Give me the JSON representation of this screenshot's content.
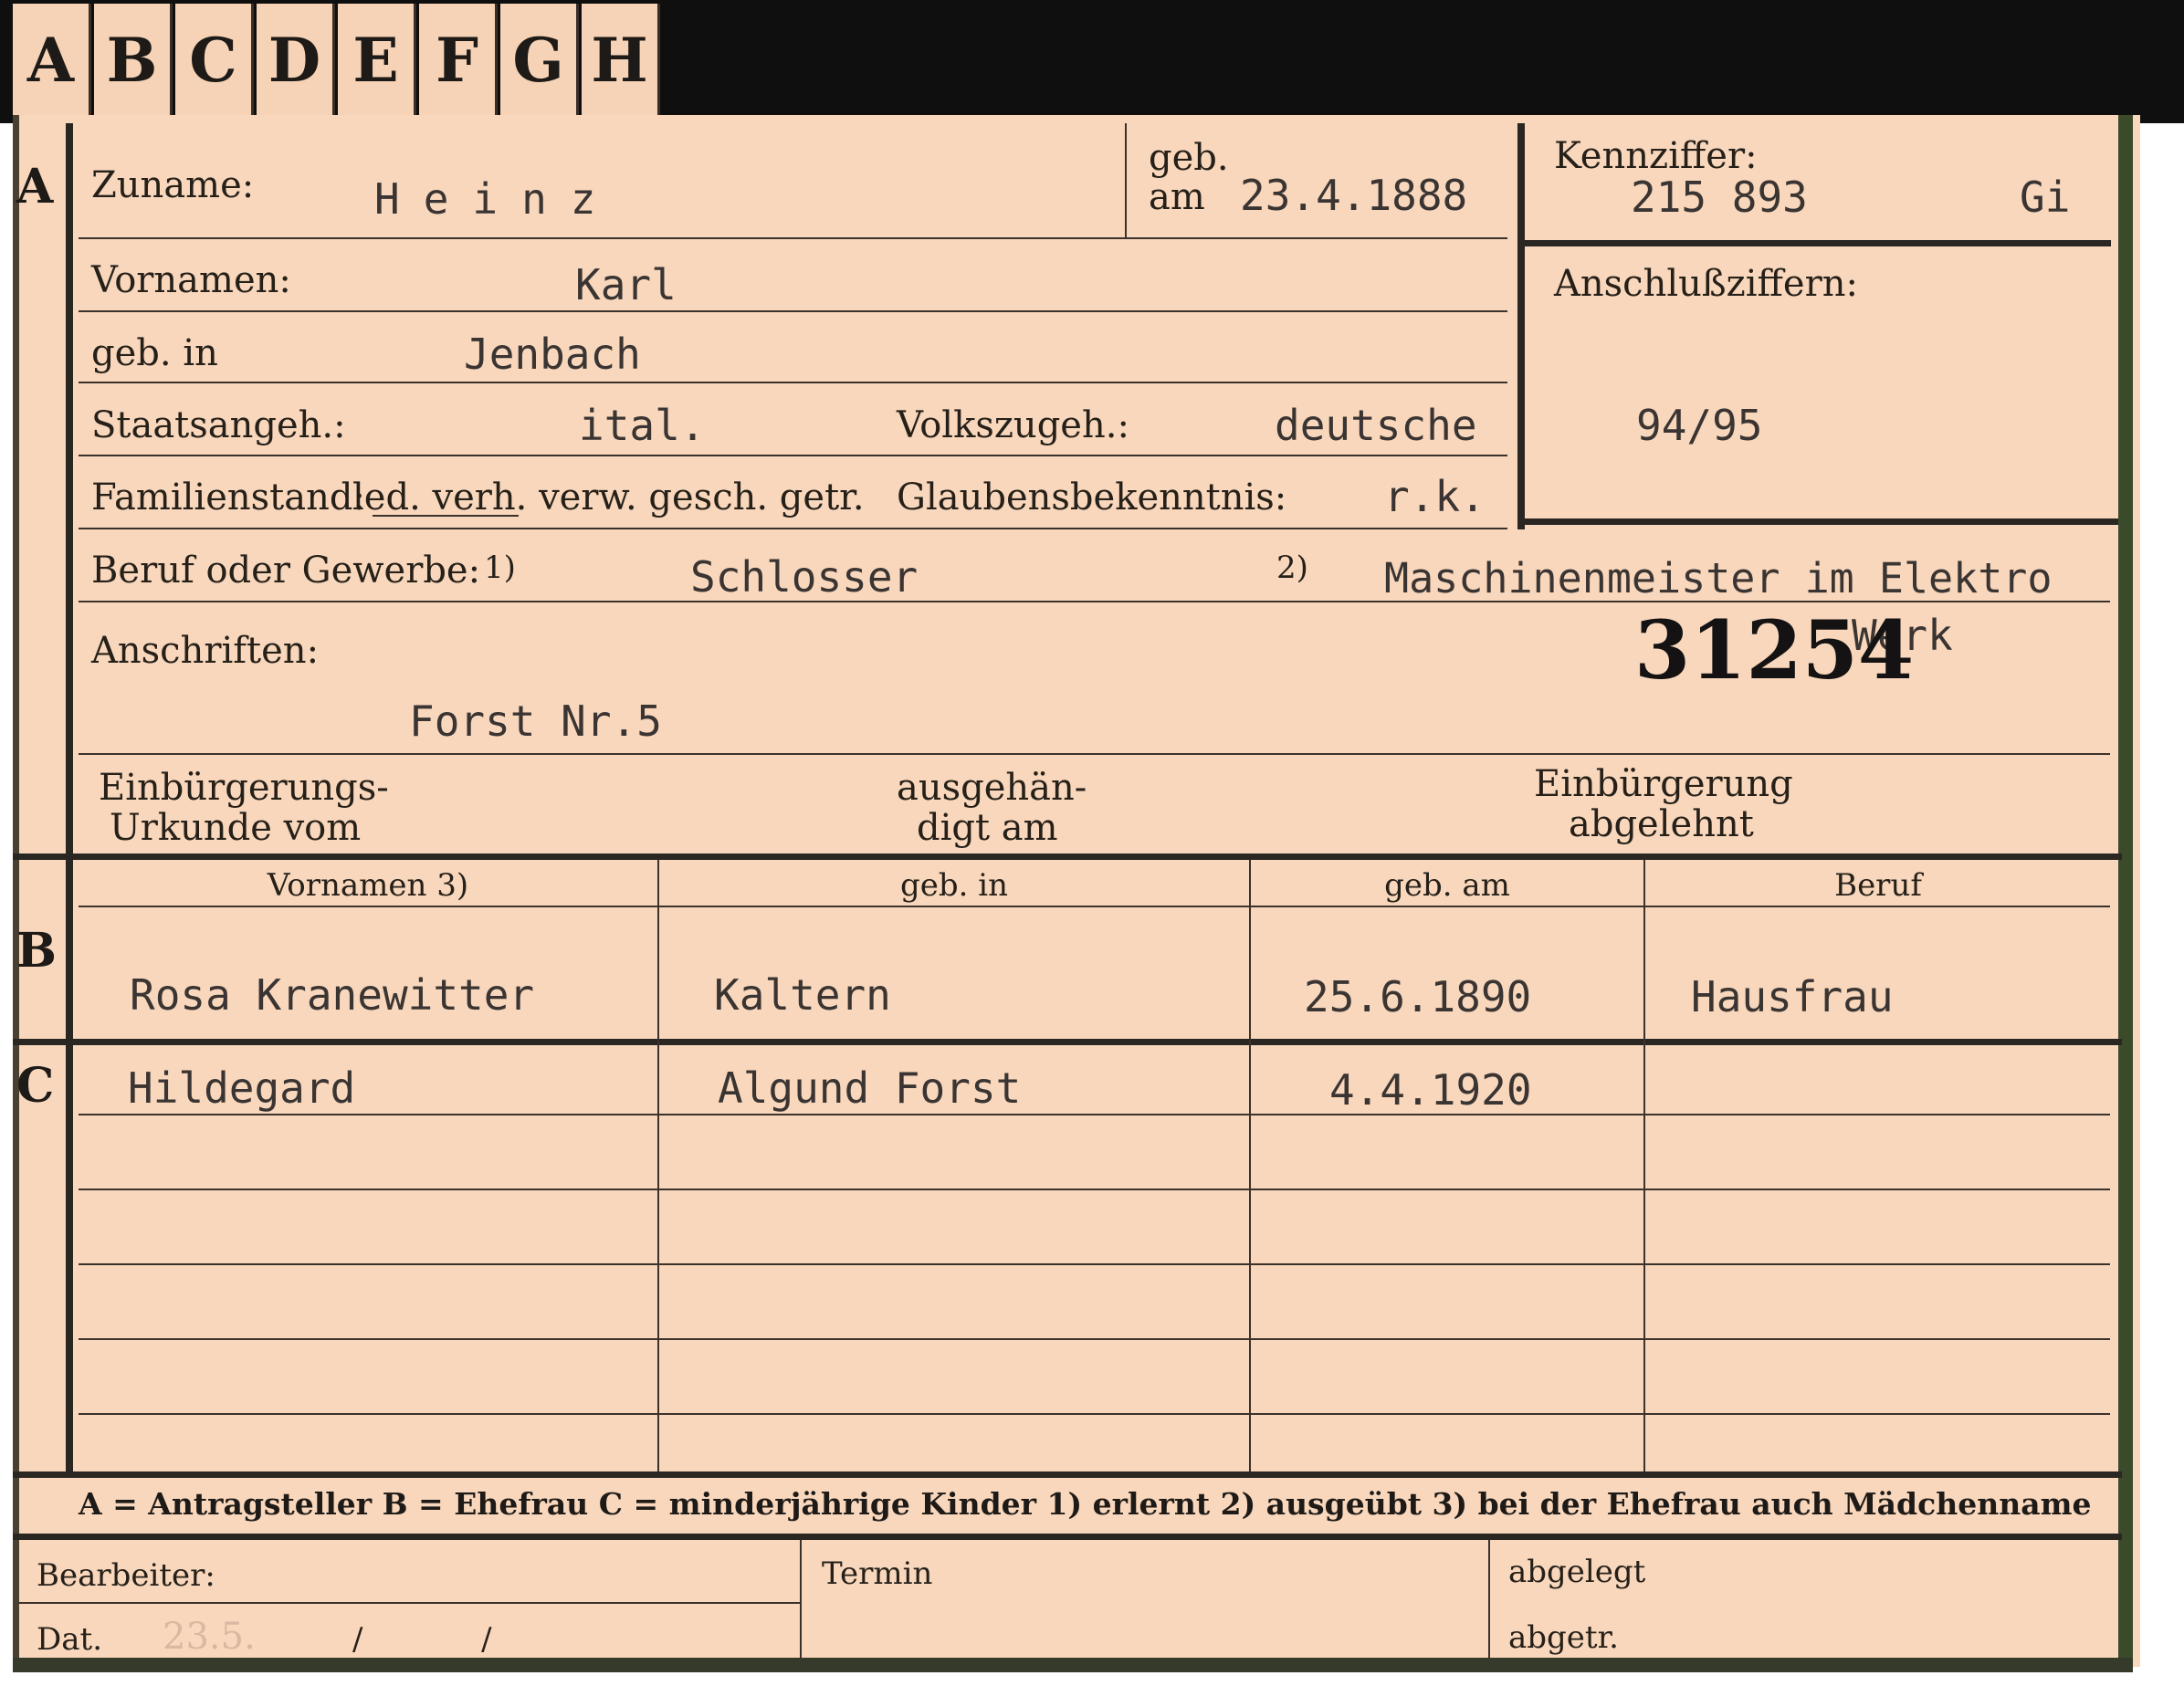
{
  "tabs": [
    "A",
    "B",
    "C",
    "D",
    "E",
    "F",
    "G",
    "H"
  ],
  "section_a": {
    "letter": "A",
    "surname_label": "Zuname:",
    "surname": "Heinz",
    "birth_date_label_1": "geb.",
    "birth_date_label_2": "am",
    "birth_date": "23.4.1888",
    "firstname_label": "Vornamen:",
    "firstname": "Karl",
    "birthplace_label": "geb. in",
    "birthplace": "Jenbach",
    "citizenship_label": "Staatsangeh.:",
    "citizenship": "ital.",
    "ethnicity_label": "Volkszugeh.:",
    "ethnicity": "deutsche",
    "marital_label": "Familienstand:",
    "marital_options": "led. verh. verw. gesch. getr.",
    "religion_label": "Glaubensbekenntnis:",
    "religion": "r.k.",
    "occupation_label": "Beruf oder Gewerbe:",
    "occupation_learned_marker": "1)",
    "occupation_learned": "Schlosser",
    "occupation_practiced_marker": "2)",
    "occupation_practiced": "Maschinenmeister im Elektro",
    "occupation_practiced_cont": "Werk",
    "address_label": "Anschriften:",
    "address": "Forst Nr.5",
    "naturalization_label_1": "Einbürgerungs-",
    "naturalization_label_2": "Urkunde vom",
    "handed_out_label_1": "ausgehän-",
    "handed_out_label_2": "digt am",
    "rejected_label_1": "Einbürgerung",
    "rejected_label_2": "abgelehnt"
  },
  "reference": {
    "label": "Kennziffer:",
    "number": "215 893",
    "code": "Gi",
    "connection_label": "Anschlußziffern:",
    "connection_value": "94/95"
  },
  "stamp_number": "31254",
  "section_b": {
    "letter": "B",
    "headers": [
      "Vornamen 3)",
      "geb. in",
      "geb. am",
      "Beruf"
    ],
    "row": [
      "Rosa Kranewitter",
      "Kaltern",
      "25.6.1890",
      "Hausfrau"
    ]
  },
  "section_c": {
    "letter": "C",
    "rows": [
      [
        "Hildegard",
        "Algund Forst",
        "4.4.1920",
        ""
      ]
    ]
  },
  "legend": "A = Antragsteller   B = Ehefrau   C = minderjährige Kinder   1) erlernt   2) ausgeübt   3) bei der Ehefrau auch Mädchenname",
  "footer": {
    "editor_label": "Bearbeiter:",
    "date_label": "Dat.",
    "date_value": "23.5.",
    "date_separators": "/            /",
    "appointment_label": "Termin",
    "filed_label": "abgelegt",
    "removed_label": "abgetr."
  }
}
